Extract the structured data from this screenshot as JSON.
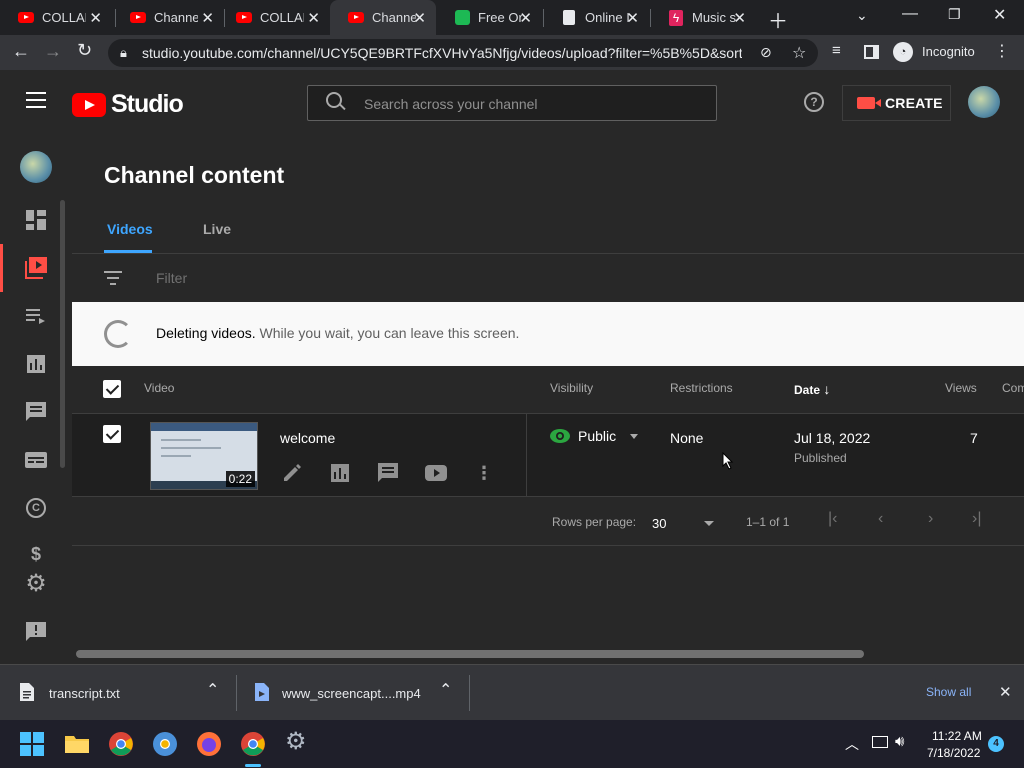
{
  "browser": {
    "tabs": [
      {
        "title": "COLLAB",
        "favicon": "youtube-icon"
      },
      {
        "title": "Channel",
        "favicon": "youtube-icon"
      },
      {
        "title": "COLLAB",
        "favicon": "youtube-icon"
      },
      {
        "title": "Channel",
        "favicon": "youtube-icon"
      },
      {
        "title": "Free On",
        "favicon": "green-app-icon"
      },
      {
        "title": "Online I",
        "favicon": "document-icon"
      },
      {
        "title": "Music s",
        "favicon": "lightning-icon"
      }
    ],
    "url": "studio.youtube.com/channel/UCY5QE9BRTFcfXVHvYa5Nfjg/videos/upload?filter=%5B%5D&sort...",
    "incognito_label": "Incognito"
  },
  "header": {
    "logo_text": "Studio",
    "search_placeholder": "Search across your channel",
    "create_label": "CREATE"
  },
  "page": {
    "title": "Channel content",
    "tabs": [
      {
        "label": "Videos"
      },
      {
        "label": "Live"
      }
    ],
    "filter_placeholder": "Filter"
  },
  "banner": {
    "bold": "Deleting videos.",
    "sub": " While you wait, you can leave this screen."
  },
  "table": {
    "headers": {
      "video": "Video",
      "visibility": "Visibility",
      "restrictions": "Restrictions",
      "date": "Date",
      "views": "Views",
      "comments": "Com"
    },
    "rows": [
      {
        "title": "welcome",
        "duration": "0:22",
        "visibility": "Public",
        "restrictions": "None",
        "date": "Jul 18, 2022",
        "status": "Published",
        "views": "7"
      }
    ]
  },
  "pagination": {
    "rows_label": "Rows per page:",
    "rows_value": "30",
    "range": "1–1 of 1"
  },
  "downloads": {
    "items": [
      {
        "name": "transcript.txt"
      },
      {
        "name": "www_screencapt....mp4"
      }
    ],
    "show_all": "Show all"
  },
  "taskbar": {
    "time": "11:22 AM",
    "date": "7/18/2022",
    "badge": "4"
  },
  "colors": {
    "accent": "#3ea6ff",
    "youtube_red": "#ff0000",
    "public_green": "#2ba640"
  }
}
